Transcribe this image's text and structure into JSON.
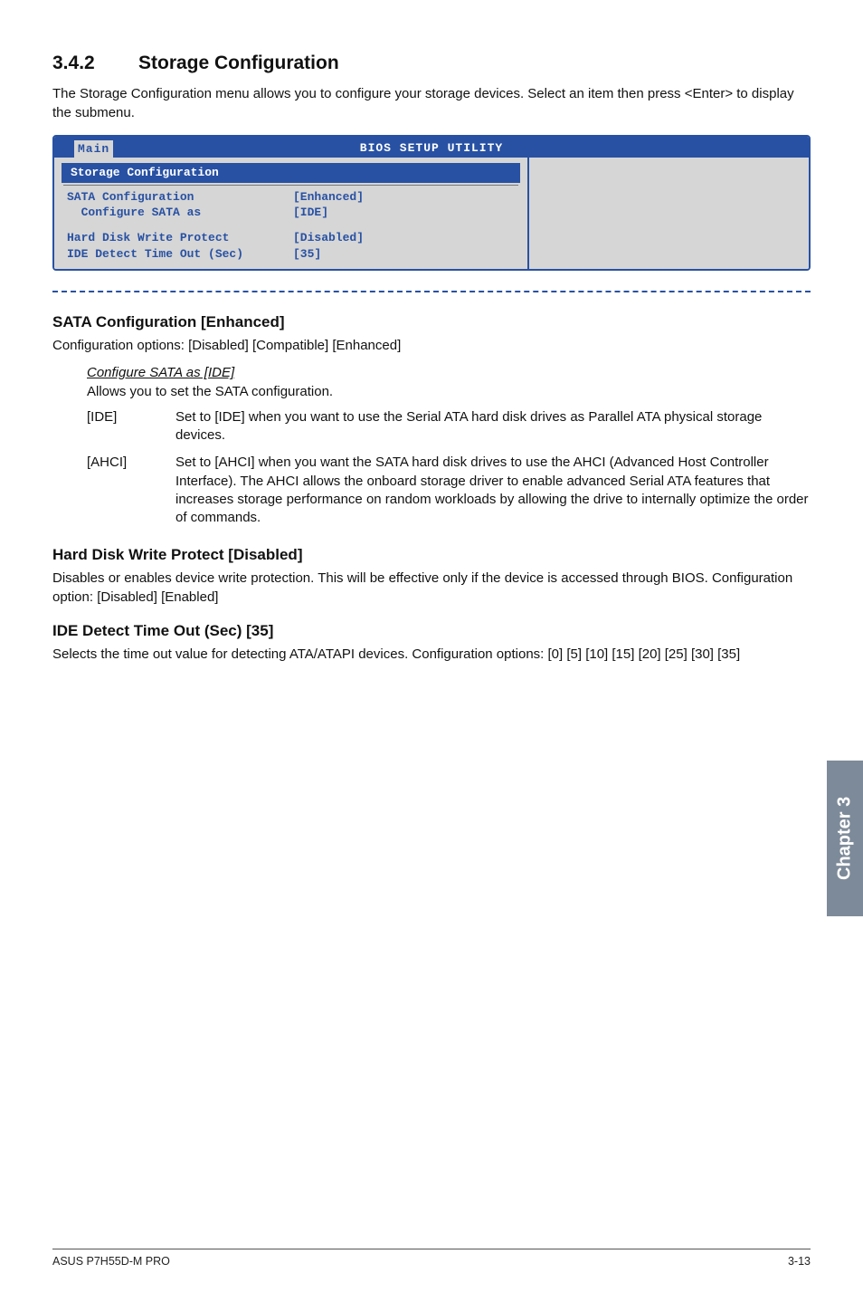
{
  "section": {
    "number": "3.4.2",
    "title": "Storage Configuration",
    "intro": "The Storage Configuration menu allows you to configure your storage devices. Select an item then press <Enter> to display the submenu."
  },
  "bios": {
    "utility_title": "BIOS SETUP UTILITY",
    "tab": "Main",
    "panel_title": "Storage Configuration",
    "rows": [
      {
        "label": "SATA Configuration",
        "value": "[Enhanced]"
      },
      {
        "label": "  Configure SATA as",
        "value": "[IDE]"
      }
    ],
    "rows2": [
      {
        "label": "Hard Disk Write Protect",
        "value": "[Disabled]"
      },
      {
        "label": "IDE Detect Time Out (Sec)",
        "value": "[35]"
      }
    ]
  },
  "sata_conf": {
    "heading": "SATA Configuration [Enhanced]",
    "text": "Configuration options: [Disabled] [Compatible] [Enhanced]",
    "sub_heading": "Configure SATA as [IDE]",
    "sub_text": "Allows you to set the SATA configuration.",
    "options": [
      {
        "label": "[IDE]",
        "text": "Set to [IDE] when you want to use the Serial ATA hard disk drives as Parallel ATA physical storage devices."
      },
      {
        "label": "[AHCI]",
        "text": "Set to [AHCI] when you want the SATA hard disk drives to use the AHCI (Advanced Host Controller Interface). The AHCI allows the onboard storage driver to enable advanced Serial ATA features that increases storage performance on random workloads by allowing the drive to internally optimize the order of commands."
      }
    ]
  },
  "hd_write": {
    "heading": "Hard Disk Write Protect [Disabled]",
    "text": "Disables or enables device write protection. This will be effective only if the device is accessed through BIOS. Configuration option: [Disabled] [Enabled]"
  },
  "ide_detect": {
    "heading": "IDE Detect Time Out (Sec) [35]",
    "text": "Selects the time out value for detecting ATA/ATAPI devices. Configuration options: [0] [5] [10] [15] [20] [25] [30] [35]"
  },
  "side_tab": "Chapter 3",
  "footer": {
    "left": "ASUS P7H55D-M PRO",
    "right": "3-13"
  }
}
